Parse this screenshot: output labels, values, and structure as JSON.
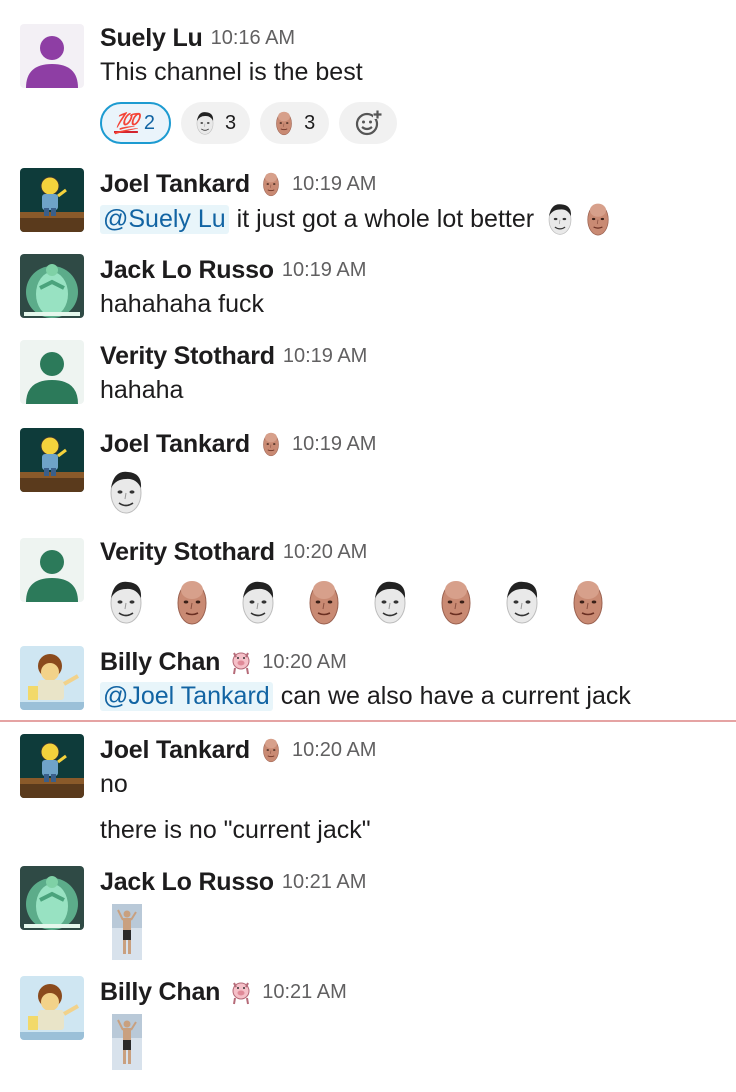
{
  "messages": [
    {
      "user": "Suely Lu",
      "time": "10:16 AM",
      "text": "This channel is the best",
      "reactions": [
        {
          "emoji": "100-emoji",
          "label": "💯",
          "count": "2",
          "active": true
        },
        {
          "emoji": "face-emoji-joel",
          "count": "3"
        },
        {
          "emoji": "face-emoji-bald",
          "count": "3"
        }
      ]
    },
    {
      "user": "Joel Tankard",
      "time": "10:19 AM",
      "mention": "@Suely Lu",
      "text": "it just got a whole lot better"
    },
    {
      "user": "Jack Lo Russo",
      "time": "10:19 AM",
      "text": "hahahaha fuck"
    },
    {
      "user": "Verity Stothard",
      "time": "10:19 AM",
      "text": "hahaha"
    },
    {
      "user": "Joel Tankard",
      "time": "10:19 AM"
    },
    {
      "user": "Verity Stothard",
      "time": "10:20 AM"
    },
    {
      "user": "Billy Chan",
      "time": "10:20 AM",
      "mention": "@Joel Tankard",
      "text": "can we also have a current jack"
    },
    {
      "user": "Joel Tankard",
      "time": "10:20 AM",
      "text": "no",
      "followup": "there is no \"current jack\""
    },
    {
      "user": "Jack Lo Russo",
      "time": "10:21 AM"
    },
    {
      "user": "Billy Chan",
      "time": "10:21 AM"
    }
  ],
  "colors": {
    "mention": "#1264a3",
    "mention_bg": "#e8f5fa",
    "timestamp": "#616061",
    "new_divider": "#e5a3a3",
    "default_avatar_purple": "#8e3ea4",
    "default_avatar_green": "#2c7a5a"
  }
}
